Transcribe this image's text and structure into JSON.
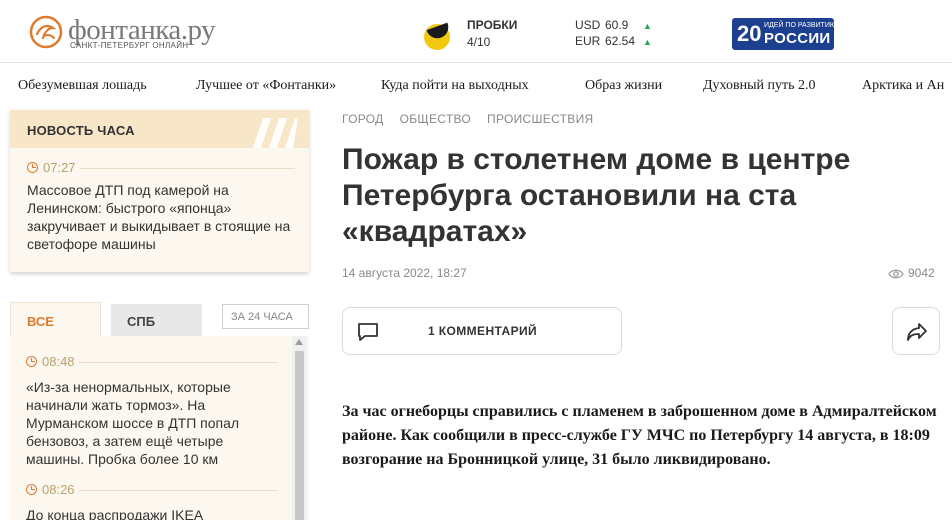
{
  "header": {
    "logo_name": "фонтанка.ру",
    "logo_sub": "САНКТ-ПЕТЕРБУРГ ОНЛАЙН",
    "traffic_label": "ПРОБКИ",
    "traffic_value": "4/10",
    "rates": [
      {
        "code": "USD",
        "value": "60.9",
        "trend": "up"
      },
      {
        "code": "EUR",
        "value": "62.54",
        "trend": "up"
      }
    ],
    "badge": {
      "number": "20",
      "top": "ИДЕЙ ПО РАЗВИТИЮ",
      "main": "РОССИИ",
      "color": "#1d3f8f"
    }
  },
  "nav": {
    "items": [
      "Обезумевшая лошадь",
      "Лучшее от «Фонтанки»",
      "Куда пойти на выходных",
      "Образ жизни",
      "Духовный путь 2.0",
      "Арктика и Ан"
    ]
  },
  "hour_news": {
    "title": "НОВОСТЬ ЧАСА",
    "time": "07:27",
    "text": "Массовое ДТП под камерой на Ленинском: быстрого «японца» закручивает и выкидывает в стоящие на светофоре машины"
  },
  "feed_tabs": {
    "all": "ВСЕ",
    "spb": "СПБ",
    "period": "ЗА 24 ЧАСА"
  },
  "feed": [
    {
      "time": "08:48",
      "text": "«Из-за ненормальных, которые начинали жать тормоз». На Мурманском шоссе в ДТП попал бензовоз, а затем ещё четыре машины. Пробка более 10 км"
    },
    {
      "time": "08:26",
      "text": "До конца распродажи IKEA"
    }
  ],
  "article": {
    "crumbs": [
      "ГОРОД",
      "ОБЩЕСТВО",
      "ПРОИСШЕСТВИЯ"
    ],
    "title": "Пожар в столетнем доме в центре Петербурга остановили на ста «квадратах»",
    "date": "14 августа 2022, 18:27",
    "views": "9042",
    "comments_label": "1 КОММЕНТАРИЙ",
    "lead": "За час огнеборцы справились с пламенем в заброшенном доме в Адмиралтейском районе. Как сообщили в пресс-службе ГУ МЧС по Петербургу 14 августа, в 18:09 возгорание на Бронницкой улице, 31 было ликвидировано."
  },
  "colors": {
    "accent": "#e07a2d",
    "muted_time": "#b9a06f",
    "card_bg": "#fdf8ef",
    "card_head": "#f7e6c8",
    "trend_up": "#2aa55a"
  }
}
